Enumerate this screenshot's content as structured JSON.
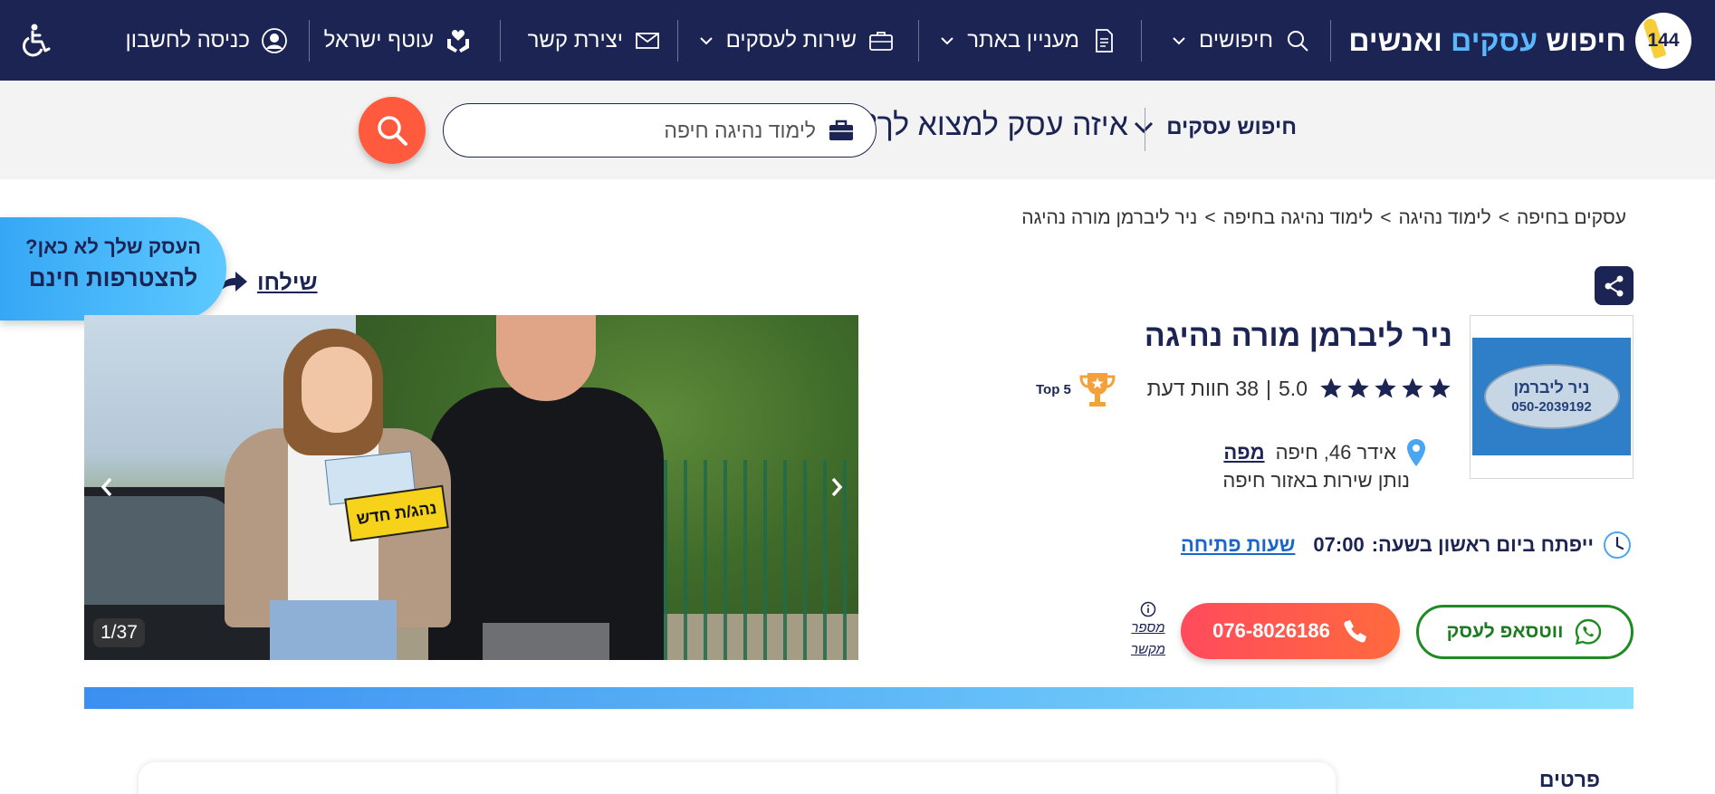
{
  "nav": {
    "logo": {
      "badge": "144",
      "word1": "חיפוש",
      "word2": "עסקים",
      "word3": "ואנשים"
    },
    "items": [
      {
        "label": "חיפושים",
        "icon": "search-icon",
        "dropdown": true
      },
      {
        "label": "מעניין באתר",
        "icon": "document-icon",
        "dropdown": true
      },
      {
        "label": "שירות לעסקים",
        "icon": "briefcase-icon",
        "dropdown": true
      },
      {
        "label": "יצירת קשר",
        "icon": "envelope-icon",
        "dropdown": false
      },
      {
        "label": "עוטף ישראל",
        "icon": "hands-heart-icon",
        "dropdown": false
      },
      {
        "label": "כניסה לחשבון",
        "icon": "user-circle-icon",
        "dropdown": false
      }
    ],
    "accessibility_icon": "accessibility-icon"
  },
  "search": {
    "category_label": "חיפוש עסקים",
    "question": "איזה עסק למצוא לך?",
    "value": "לימוד נהיגה חיפה",
    "colors": {
      "button": "#ff5a3d",
      "border": "#1b2453"
    }
  },
  "breadcrumb": {
    "items": [
      "עסקים בחיפה",
      "לימוד נהיגה",
      "לימוד נהיגה בחיפה",
      "ניר ליברמן מורה נהיגה"
    ],
    "separator": ">"
  },
  "join": {
    "line1": "העסק שלך לא כאן?",
    "line2": "להצטרפות חינם"
  },
  "send_link": "שילחו",
  "gallery": {
    "counter": "1/37",
    "plate_text": "נהג/ת חדש"
  },
  "business": {
    "name": "ניר ליברמן מורה נהיגה",
    "logo_name": "ניר ליברמן",
    "logo_phone": "050-2039192",
    "rating": "5.0",
    "reviews": "38 חוות דעת",
    "stars": 5,
    "badge": "Top 5",
    "address": "אידר 46, חיפה",
    "map_link": "מפה",
    "service_area": "נותן שירות באזור חיפה",
    "hours_text": "ייפתח ביום ראשון בשעה:",
    "hours_time": "07:00",
    "hours_link": "שעות פתיחה",
    "whatsapp_label": "ווטסאפ לעסק",
    "phone": "076-8026186",
    "contact_number_label_1": "מספר",
    "contact_number_label_2": "מקשר"
  },
  "details_label": "פרטים",
  "colors": {
    "navy": "#1b2453",
    "accent_blue": "#5ab8ff",
    "whatsapp_green": "#1e8a23",
    "phone_red": "#ff4b5c"
  }
}
